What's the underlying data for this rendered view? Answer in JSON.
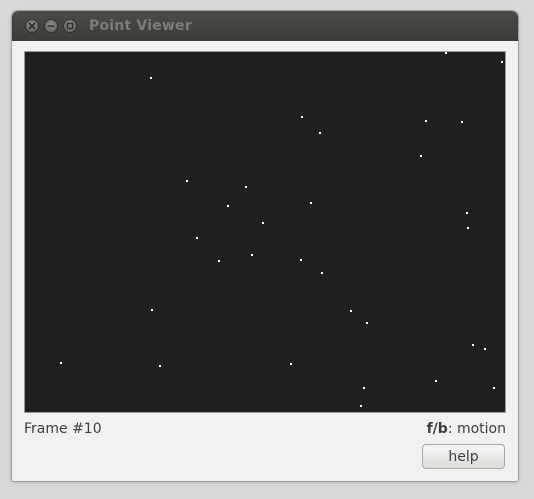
{
  "window": {
    "title": "Point Viewer"
  },
  "canvas": {
    "background": "#1f1f1f",
    "point_color": "#ffffff",
    "x_range": [
      0,
      480
    ],
    "y_range": [
      0,
      360
    ],
    "points": [
      [
        125,
        25
      ],
      [
        420,
        0
      ],
      [
        476,
        9
      ],
      [
        276,
        64
      ],
      [
        294,
        80
      ],
      [
        400,
        68
      ],
      [
        436,
        69
      ],
      [
        395,
        103
      ],
      [
        161,
        128
      ],
      [
        220,
        134
      ],
      [
        202,
        153
      ],
      [
        285,
        150
      ],
      [
        237,
        170
      ],
      [
        441,
        160
      ],
      [
        442,
        175
      ],
      [
        171,
        185
      ],
      [
        226,
        202
      ],
      [
        193,
        208
      ],
      [
        275,
        207
      ],
      [
        296,
        220
      ],
      [
        126,
        257
      ],
      [
        325,
        258
      ],
      [
        341,
        270
      ],
      [
        447,
        292
      ],
      [
        459,
        296
      ],
      [
        35,
        310
      ],
      [
        134,
        313
      ],
      [
        265,
        311
      ],
      [
        410,
        328
      ],
      [
        338,
        335
      ],
      [
        468,
        335
      ],
      [
        335,
        353
      ]
    ]
  },
  "status": {
    "frame_label": "Frame #10",
    "hint_key": "f/b",
    "hint_text": ": motion"
  },
  "help_button": {
    "label": "help"
  }
}
